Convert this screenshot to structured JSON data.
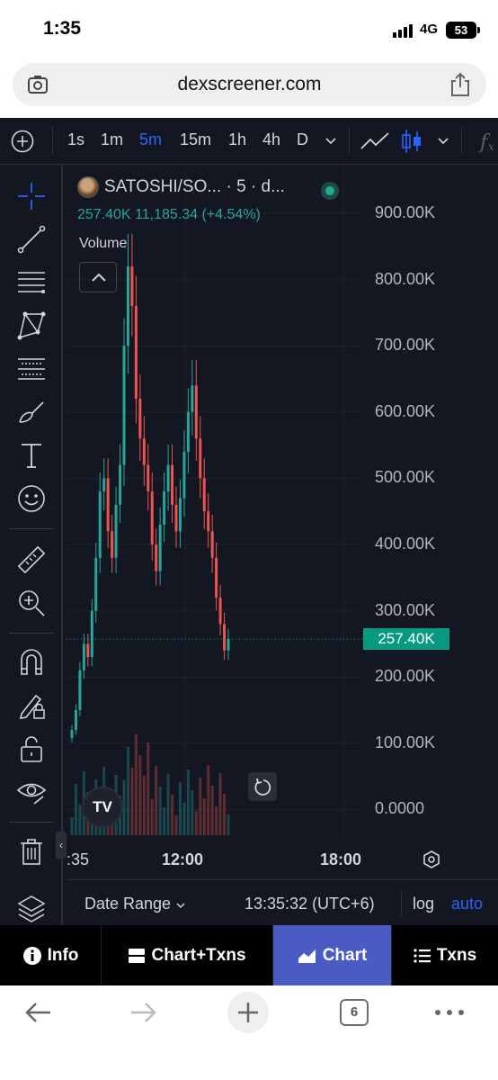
{
  "status_bar": {
    "time": "1:35",
    "network": "4G",
    "battery": "53"
  },
  "browser": {
    "url": "dexscreener.com",
    "tab_count": "6"
  },
  "toolbar": {
    "intervals": [
      "1s",
      "1m",
      "5m",
      "15m",
      "1h",
      "4h",
      "D"
    ],
    "active_interval": "5m"
  },
  "chart": {
    "pair": "SATOSHI/SO... · 5 · d...",
    "price": "257.40K",
    "ohlc_summary": "11,185.34 (+4.54%)",
    "volume_label": "Volume",
    "price_axis": [
      "900.00K",
      "800.00K",
      "700.00K",
      "600.00K",
      "500.00K",
      "400.00K",
      "300.00K",
      "200.00K",
      "100.00K",
      "0.0000"
    ],
    "current_price_tag": "257.40K",
    "time_axis": [
      ":35",
      "12:00",
      "18:00"
    ],
    "up_color": "#26a69a",
    "down_color": "#ef5350"
  },
  "chart_data": {
    "type": "candlestick",
    "title": "SATOSHI/SO... · 5 · d...",
    "ylim": [
      0,
      950000
    ],
    "x_ticks": [
      ":35",
      "12:00",
      "18:00"
    ],
    "series": [
      {
        "name": "price",
        "close_path": [
          120000,
          150000,
          210000,
          250000,
          230000,
          300000,
          380000,
          480000,
          500000,
          420000,
          380000,
          460000,
          520000,
          700000,
          820000,
          760000,
          620000,
          560000,
          520000,
          480000,
          400000,
          360000,
          430000,
          480000,
          520000,
          460000,
          420000,
          470000,
          540000,
          600000,
          640000,
          560000,
          500000,
          450000,
          420000,
          380000,
          320000,
          280000,
          240000,
          257400
        ]
      }
    ]
  },
  "bottom_bar": {
    "date_range": "Date Range",
    "time_zone": "13:35:32 (UTC+6)",
    "log": "log",
    "auto": "auto"
  },
  "nav_tabs": {
    "info": "Info",
    "chart_txns": "Chart+Txns",
    "chart": "Chart",
    "txns": "Txns"
  }
}
